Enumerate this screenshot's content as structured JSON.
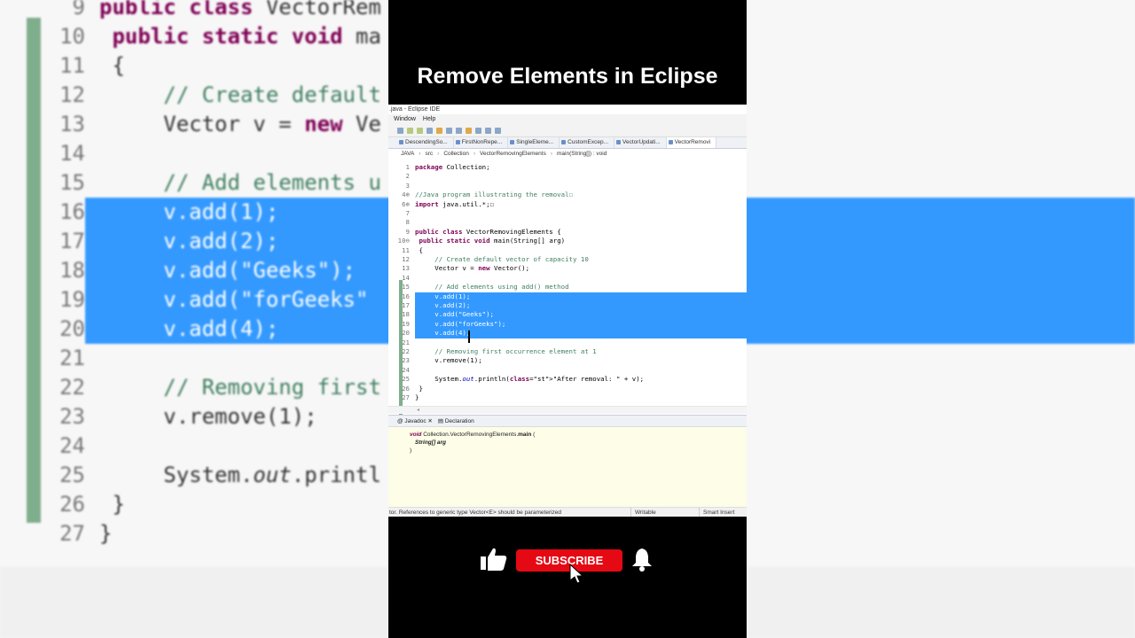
{
  "video_title": "Remove Elements in Eclipse",
  "window": {
    "title": ".java - Eclipse IDE",
    "menu": [
      "Window",
      "Help"
    ]
  },
  "editor_tabs": [
    "DescendingSo...",
    "FirstNonRepe...",
    "SingleEleme...",
    "CustomExcep...",
    "VectorUpdati...",
    "VectorRemovi"
  ],
  "breadcrumb": [
    "JAVA",
    "src",
    "Collection",
    "VectorRemovingElements",
    "main(String[]) : void"
  ],
  "code_lines": [
    {
      "num": "1",
      "code": "package Collection;"
    },
    {
      "num": "2",
      "code": ""
    },
    {
      "num": "3",
      "code": ""
    },
    {
      "num": "4⊕",
      "code": "//Java program illustrating the removal☐"
    },
    {
      "num": "6⊕",
      "code": "import java.util.*;☐"
    },
    {
      "num": "7",
      "code": ""
    },
    {
      "num": "8",
      "code": ""
    },
    {
      "num": "9",
      "code": "public class VectorRemovingElements {"
    },
    {
      "num": "10⊖",
      "code": " public static void main(String[] arg)"
    },
    {
      "num": "11",
      "code": " {"
    },
    {
      "num": "12",
      "code": "     // Create default vector of capacity 10"
    },
    {
      "num": "13",
      "code": "     Vector v = new Vector();"
    },
    {
      "num": "14",
      "code": ""
    },
    {
      "num": "15",
      "code": "     // Add elements using add() method"
    },
    {
      "num": "16",
      "code": "     v.add(1);"
    },
    {
      "num": "17",
      "code": "     v.add(2);"
    },
    {
      "num": "18",
      "code": "     v.add(\"Geeks\");"
    },
    {
      "num": "19",
      "code": "     v.add(\"forGeeks\");"
    },
    {
      "num": "20",
      "code": "     v.add(4);"
    },
    {
      "num": "21",
      "code": ""
    },
    {
      "num": "22",
      "code": "     // Removing first occurrence element at 1"
    },
    {
      "num": "23",
      "code": "     v.remove(1);"
    },
    {
      "num": "24",
      "code": ""
    },
    {
      "num": "25",
      "code": "     System.out.println(\"After removal: \" + v);"
    },
    {
      "num": "26",
      "code": " }"
    },
    {
      "num": "27",
      "code": "}"
    }
  ],
  "bottom_tabs": [
    "Javadoc",
    "Declaration"
  ],
  "javadoc": {
    "line1_kw": "void",
    "line1_rest": "Collection.VectorRemovingElements.",
    "line1_method": "main",
    "line1_paren": "(",
    "line2": "String[] arg",
    "line3": ")"
  },
  "status": {
    "message": "tor. References to generic type Vector<E> should be parameterized",
    "writable": "Writable",
    "insert": "Smart Insert"
  },
  "subscribe_label": "SUBSCRIBE",
  "colors": {
    "selection": "#3399ff",
    "subscribe": "#e50914",
    "keyword": "#7f0055",
    "comment": "#3f7f5f",
    "string": "#2a00ff"
  }
}
